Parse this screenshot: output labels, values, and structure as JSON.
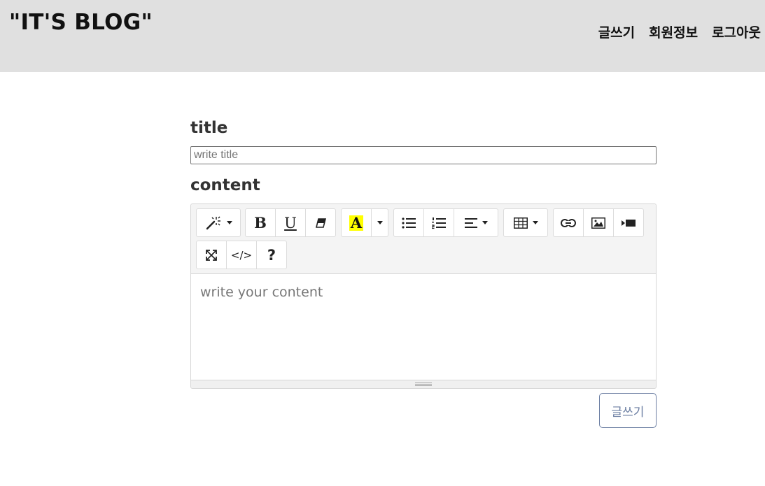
{
  "header": {
    "brand": "\"IT'S BLOG\"",
    "nav": {
      "write": "글쓰기",
      "member_info": "회원정보",
      "logout": "로그아웃"
    }
  },
  "form": {
    "title_label": "title",
    "title_placeholder": "write title",
    "content_label": "content",
    "content_placeholder": "write your content",
    "submit_label": "글쓰기"
  },
  "toolbar": {
    "bold_glyph": "B",
    "underline_glyph": "U",
    "highlight_glyph": "A",
    "codeview_glyph": "</>",
    "help_glyph": "?",
    "highlight_color": "#ffff00"
  },
  "icons": [
    "magic-icon",
    "bold-icon",
    "underline-icon",
    "eraser-icon",
    "font-color-icon",
    "unordered-list-icon",
    "ordered-list-icon",
    "align-icon",
    "table-icon",
    "link-icon",
    "picture-icon",
    "video-icon",
    "fullscreen-icon",
    "codeview-icon",
    "help-icon"
  ],
  "colors": {
    "header_bg": "#e0e0e0",
    "toolbar_bg": "#f4f4f4",
    "submit_border": "#6c7fa3"
  }
}
